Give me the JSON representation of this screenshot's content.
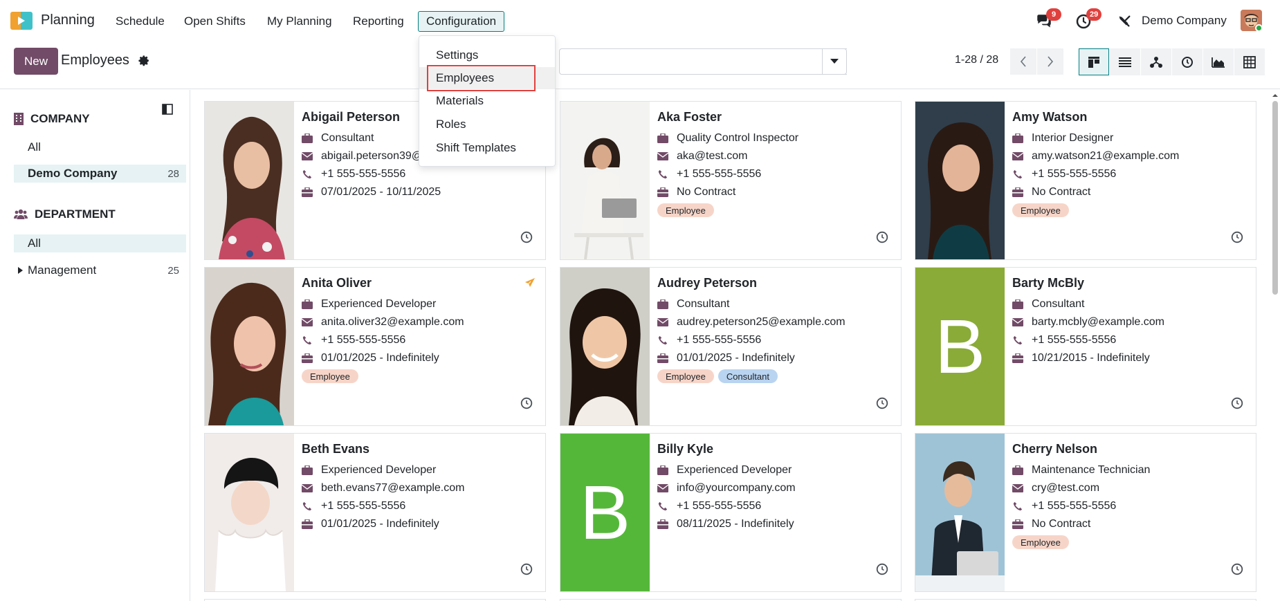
{
  "nav": {
    "app_name": "Planning",
    "menus": [
      "Schedule",
      "Open Shifts",
      "My Planning",
      "Reporting",
      "Configuration"
    ],
    "messages_badge": "9",
    "activities_badge": "29",
    "company": "Demo Company"
  },
  "control": {
    "new_label": "New",
    "breadcrumb": "Employees",
    "pager": "1-28 / 28"
  },
  "dropdown": {
    "items": [
      "Settings",
      "Employees",
      "Materials",
      "Roles",
      "Shift Templates"
    ]
  },
  "sidebar": {
    "company_title": "COMPANY",
    "company_items": [
      {
        "label": "All",
        "count": ""
      },
      {
        "label": "Demo Company",
        "count": "28"
      }
    ],
    "department_title": "DEPARTMENT",
    "department_items": [
      {
        "label": "All",
        "count": ""
      },
      {
        "label": "Management",
        "count": "25"
      }
    ]
  },
  "employees": [
    {
      "name": "Abigail Peterson",
      "job": "Consultant",
      "email": "abigail.peterson39@example.com",
      "phone": "+1 555-555-5556",
      "contract": "07/01/2025 - 10/11/2025",
      "tags": []
    },
    {
      "name": "Aka Foster",
      "job": "Quality Control Inspector",
      "email": "aka@test.com",
      "phone": "+1 555-555-5556",
      "contract": "No Contract",
      "tags": [
        "Employee"
      ]
    },
    {
      "name": "Amy Watson",
      "job": "Interior Designer",
      "email": "amy.watson21@example.com",
      "phone": "+1 555-555-5556",
      "contract": "No Contract",
      "tags": [
        "Employee"
      ]
    },
    {
      "name": "Anita Oliver",
      "job": "Experienced Developer",
      "email": "anita.oliver32@example.com",
      "phone": "+1 555-555-5556",
      "contract": "01/01/2025 - Indefinitely",
      "tags": [
        "Employee"
      ]
    },
    {
      "name": "Audrey Peterson",
      "job": "Consultant",
      "email": "audrey.peterson25@example.com",
      "phone": "+1 555-555-5556",
      "contract": "01/01/2025 - Indefinitely",
      "tags": [
        "Employee",
        "Consultant"
      ]
    },
    {
      "name": "Barty McBly",
      "job": "Consultant",
      "email": "barty.mcbly@example.com",
      "phone": "+1 555-555-5556",
      "contract": "10/21/2015 - Indefinitely",
      "tags": [],
      "initial": "B"
    },
    {
      "name": "Beth Evans",
      "job": "Experienced Developer",
      "email": "beth.evans77@example.com",
      "phone": "+1 555-555-5556",
      "contract": "01/01/2025 - Indefinitely",
      "tags": []
    },
    {
      "name": "Billy Kyle",
      "job": "Experienced Developer",
      "email": "info@yourcompany.com",
      "phone": "+1 555-555-5556",
      "contract": "08/11/2025 - Indefinitely",
      "tags": [],
      "initial": "B"
    },
    {
      "name": "Cherry Nelson",
      "job": "Maintenance Technician",
      "email": "cry@test.com",
      "phone": "+1 555-555-5556",
      "contract": "No Contract",
      "tags": [
        "Employee"
      ]
    }
  ],
  "colors": {
    "brand": "#714b67",
    "accent": "#017e84",
    "tag_employee": "#f6d5c8",
    "tag_consultant": "#b9d4f0",
    "barty_bg": "#8aab37",
    "billy_bg": "#55b73a"
  }
}
